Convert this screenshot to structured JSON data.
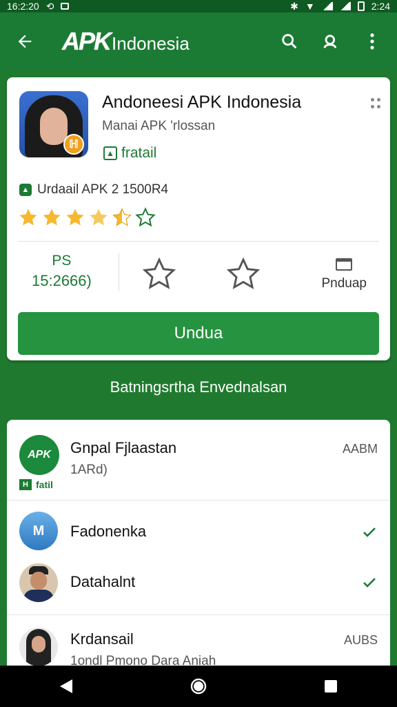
{
  "status_bar": {
    "time": "16:2:20",
    "right_time": "2:24",
    "icons": [
      "sync-icon",
      "notification-icon",
      "bluetooth-icon",
      "wifi-icon",
      "signal-icon",
      "battery-icon"
    ]
  },
  "app_bar": {
    "logo_mark": "APK",
    "logo_text": "Indonesia",
    "actions": [
      "search-icon",
      "account-search-icon",
      "more-vert-icon"
    ]
  },
  "app": {
    "title": "Andoneesi APK Indonesia",
    "subtitle": "Manai APK 'rlossan",
    "installed_label": "fratail",
    "icon_badge": "ℍ",
    "version_text": "Urdaail APK 2 1500R4",
    "rating": 4.5,
    "stats": {
      "ps_label": "PS",
      "ps_value": "15:2666)",
      "pnduap_label": "Pnduap"
    },
    "cta_label": "Undua"
  },
  "section_title": "Batningsrtha Envednalsan",
  "list": {
    "items": [
      {
        "name": "Gnpal Fjlaastan",
        "sub": "1ARd)",
        "meta": "AABM",
        "badge": "fatil",
        "badge_mark": "H",
        "avatar_mark": "APK"
      },
      {
        "name": "Fadonenka",
        "meta": "",
        "checked": true,
        "avatar_mark": "M"
      },
      {
        "name": "Datahalnt",
        "meta": "",
        "checked": true
      },
      {
        "name": "Krdansail",
        "sub": "1ondl  Pmono Dara Aniah",
        "meta": "AUBS"
      }
    ]
  },
  "colors": {
    "primary": "#1b7a34",
    "accent": "#25933f",
    "star": "#f5b82e"
  }
}
